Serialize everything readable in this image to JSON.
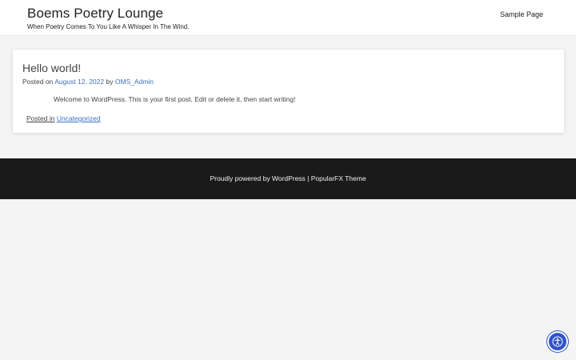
{
  "header": {
    "site_title": "Boems Poetry Lounge",
    "tagline": "When Poetry Comes To You Like A Whisper In The Wind.",
    "nav_items": [
      {
        "label": "Sample Page"
      }
    ]
  },
  "post": {
    "title": "Hello world!",
    "meta_prefix": "Posted on",
    "date": "August 12, 2022",
    "by_text": "by",
    "author": "OMS_Admin",
    "content": "Welcome to WordPress. This is your first post. Edit or delete it, then start writing!",
    "posted_in_label": "Posted in",
    "category": "Uncategorized"
  },
  "footer": {
    "text": "Proudly powered by WordPress | PopularFX Theme"
  },
  "colors": {
    "link": "#3f6fc6",
    "footer_bg": "#1a1a1a",
    "page_bg": "#f4f4f4",
    "accessibility_button": "#2f54c8"
  },
  "icons": {
    "accessibility": "accessibility-icon"
  }
}
